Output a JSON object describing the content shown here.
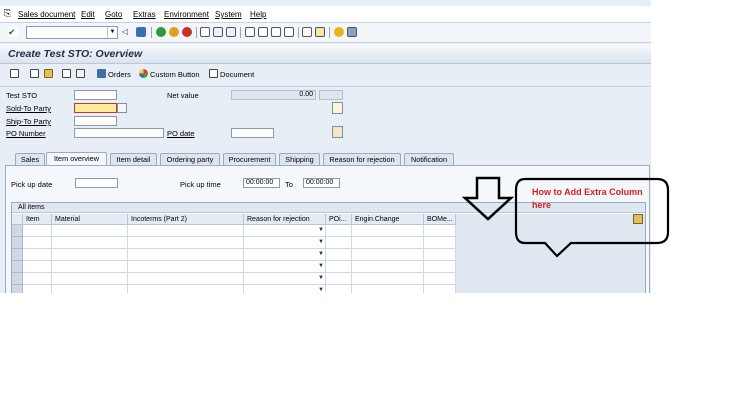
{
  "menubar": {
    "items": [
      "Sales document",
      "Edit",
      "Goto",
      "Extras",
      "Environment",
      "System",
      "Help"
    ]
  },
  "title": "Create Test STO: Overview",
  "app_toolbar": {
    "orders": "Orders",
    "custom_button": "Custom Button",
    "document": "Document"
  },
  "header": {
    "test_sto_label": "Test STO",
    "net_value_label": "Net value",
    "net_value": "0.00",
    "sold_to_label": "Sold-To Party",
    "ship_to_label": "Ship-To Party",
    "po_number_label": "PO Number",
    "po_date_label": "PO date"
  },
  "tabs": [
    "Sales",
    "Item overview",
    "Item detail",
    "Ordering party",
    "Procurement",
    "Shipping",
    "Reason for rejection",
    "Notification"
  ],
  "item_overview": {
    "pickup_date_label": "Pick up date",
    "pickup_time_label": "Pick up time",
    "time_from": "00:00:00",
    "to_label": "To",
    "time_to": "00:00:00",
    "grid_title": "All items",
    "columns": [
      "Item",
      "Material",
      "Incoterms (Part 2)",
      "Reason for rejection",
      "POi...",
      "Engin.Change",
      "BOMe..."
    ]
  },
  "annotation": {
    "text": "How to Add Extra Column here"
  },
  "colors": {
    "annotation_red": "#d81f1f",
    "required_field": "#ffeb99",
    "sap_background": "#e8eef6"
  }
}
